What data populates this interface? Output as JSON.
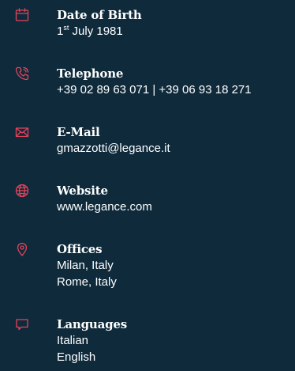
{
  "colors": {
    "background": "#0e2a3b",
    "accent_icon": "#e5435a",
    "text": "#ffffff"
  },
  "contact": {
    "birth": {
      "icon": "calendar-icon",
      "label": "Date of Birth",
      "day": "1",
      "ordinal": "st",
      "rest": " July 1981"
    },
    "phone": {
      "icon": "phone-icon",
      "label": "Telephone",
      "value": "+39 02 89 63 071 | +39 06 93 18 271"
    },
    "email": {
      "icon": "envelope-icon",
      "label": "E-Mail",
      "value": "gmazzotti@legance.it"
    },
    "website": {
      "icon": "globe-icon",
      "label": "Website",
      "value": "www.legance.com"
    },
    "offices": {
      "icon": "map-pin-icon",
      "label": "Offices",
      "values": [
        "Milan, Italy",
        "Rome, Italy"
      ]
    },
    "languages": {
      "icon": "chat-bubble-icon",
      "label": "Languages",
      "values": [
        "Italian",
        "English"
      ]
    }
  }
}
